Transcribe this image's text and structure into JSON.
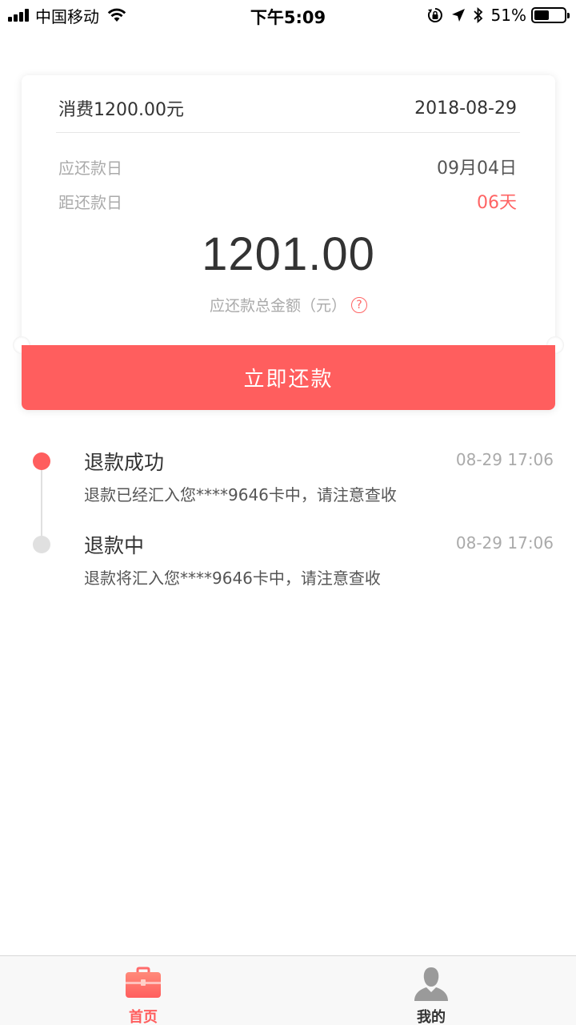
{
  "status_bar": {
    "carrier": "中国移动",
    "time": "下午5:09",
    "battery_pct": "51%",
    "battery_level": 0.51,
    "icons": [
      "signal-icon",
      "wifi-icon",
      "rotation-lock-icon",
      "location-arrow-icon",
      "bluetooth-icon",
      "battery-icon"
    ]
  },
  "bill": {
    "consume_label": "消费1200.00元",
    "consume_date": "2018-08-29",
    "due_label": "应还款日",
    "due_date": "09月04日",
    "distance_label": "距还款日",
    "distance_value": "06天",
    "amount": "1201.00",
    "amount_label": "应还款总金额（元）",
    "help_icon": "question-circle-icon",
    "repay_button": "立即还款",
    "accent_color": "#ff5e5e"
  },
  "timeline": {
    "items": [
      {
        "title": "退款成功",
        "time": "08-29 17:06",
        "desc": "退款已经汇入您****9646卡中，请注意查收",
        "status": "done"
      },
      {
        "title": "退款中",
        "time": "08-29 17:06",
        "desc": "退款将汇入您****9646卡中，请注意查收",
        "status": "pending"
      }
    ]
  },
  "tabbar": {
    "tabs": [
      {
        "label": "首页",
        "icon": "briefcase-icon",
        "active": true
      },
      {
        "label": "我的",
        "icon": "user-icon",
        "active": false
      }
    ]
  }
}
